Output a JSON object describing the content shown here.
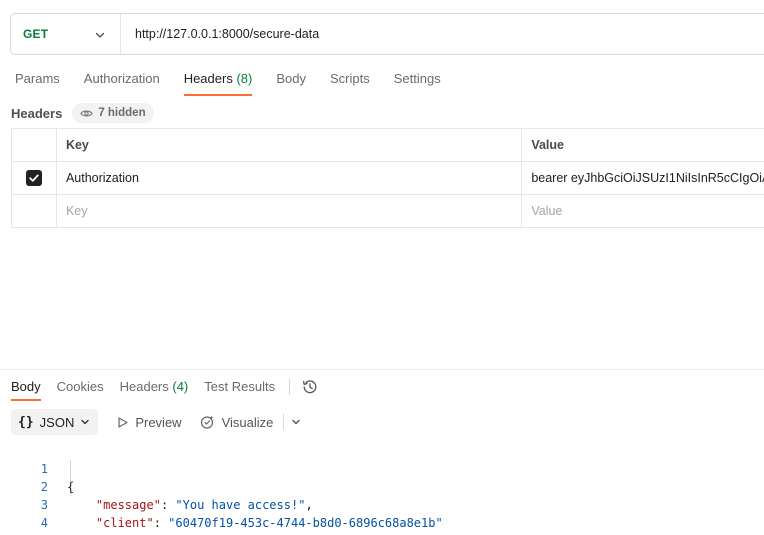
{
  "request": {
    "method": "GET",
    "url": "http://127.0.0.1:8000/secure-data"
  },
  "request_tabs": [
    {
      "label": "Params"
    },
    {
      "label": "Authorization"
    },
    {
      "label": "Headers",
      "count": "(8)"
    },
    {
      "label": "Body"
    },
    {
      "label": "Scripts"
    },
    {
      "label": "Settings"
    }
  ],
  "active_request_tab": "Headers",
  "headers_section": {
    "title": "Headers",
    "hidden_label": "7 hidden",
    "columns": {
      "key": "Key",
      "value": "Value"
    },
    "rows": [
      {
        "checked": true,
        "key": "Authorization",
        "value": "bearer eyJhbGciOiJSUzI1NiIsInR5cCIgOiA"
      }
    ],
    "new_row": {
      "key_placeholder": "Key",
      "value_placeholder": "Value"
    }
  },
  "response_tabs": [
    {
      "label": "Body"
    },
    {
      "label": "Cookies"
    },
    {
      "label": "Headers",
      "count": "(4)"
    },
    {
      "label": "Test Results"
    }
  ],
  "active_response_tab": "Body",
  "body_toolbar": {
    "format_braces": "{}",
    "format_label": "JSON",
    "preview_label": "Preview",
    "visualize_label": "Visualize"
  },
  "response_body": {
    "line_numbers": [
      "1",
      "2",
      "3",
      "4"
    ],
    "open_brace": "{",
    "close_brace": "}",
    "fields": [
      {
        "key": "\"message\"",
        "sep": ": ",
        "value": "\"You have access!\"",
        "trail": ","
      },
      {
        "key": "\"client\"",
        "sep": ": ",
        "value": "\"60470f19-453c-4744-b8d0-6896c68a8e1b\"",
        "trail": ""
      }
    ]
  },
  "colors": {
    "method_get": "#0b7a3b",
    "active_tab_underline": "#ff6c37",
    "json_key": "#a31515",
    "json_string": "#0451a5",
    "line_number": "#2a6cbf"
  }
}
